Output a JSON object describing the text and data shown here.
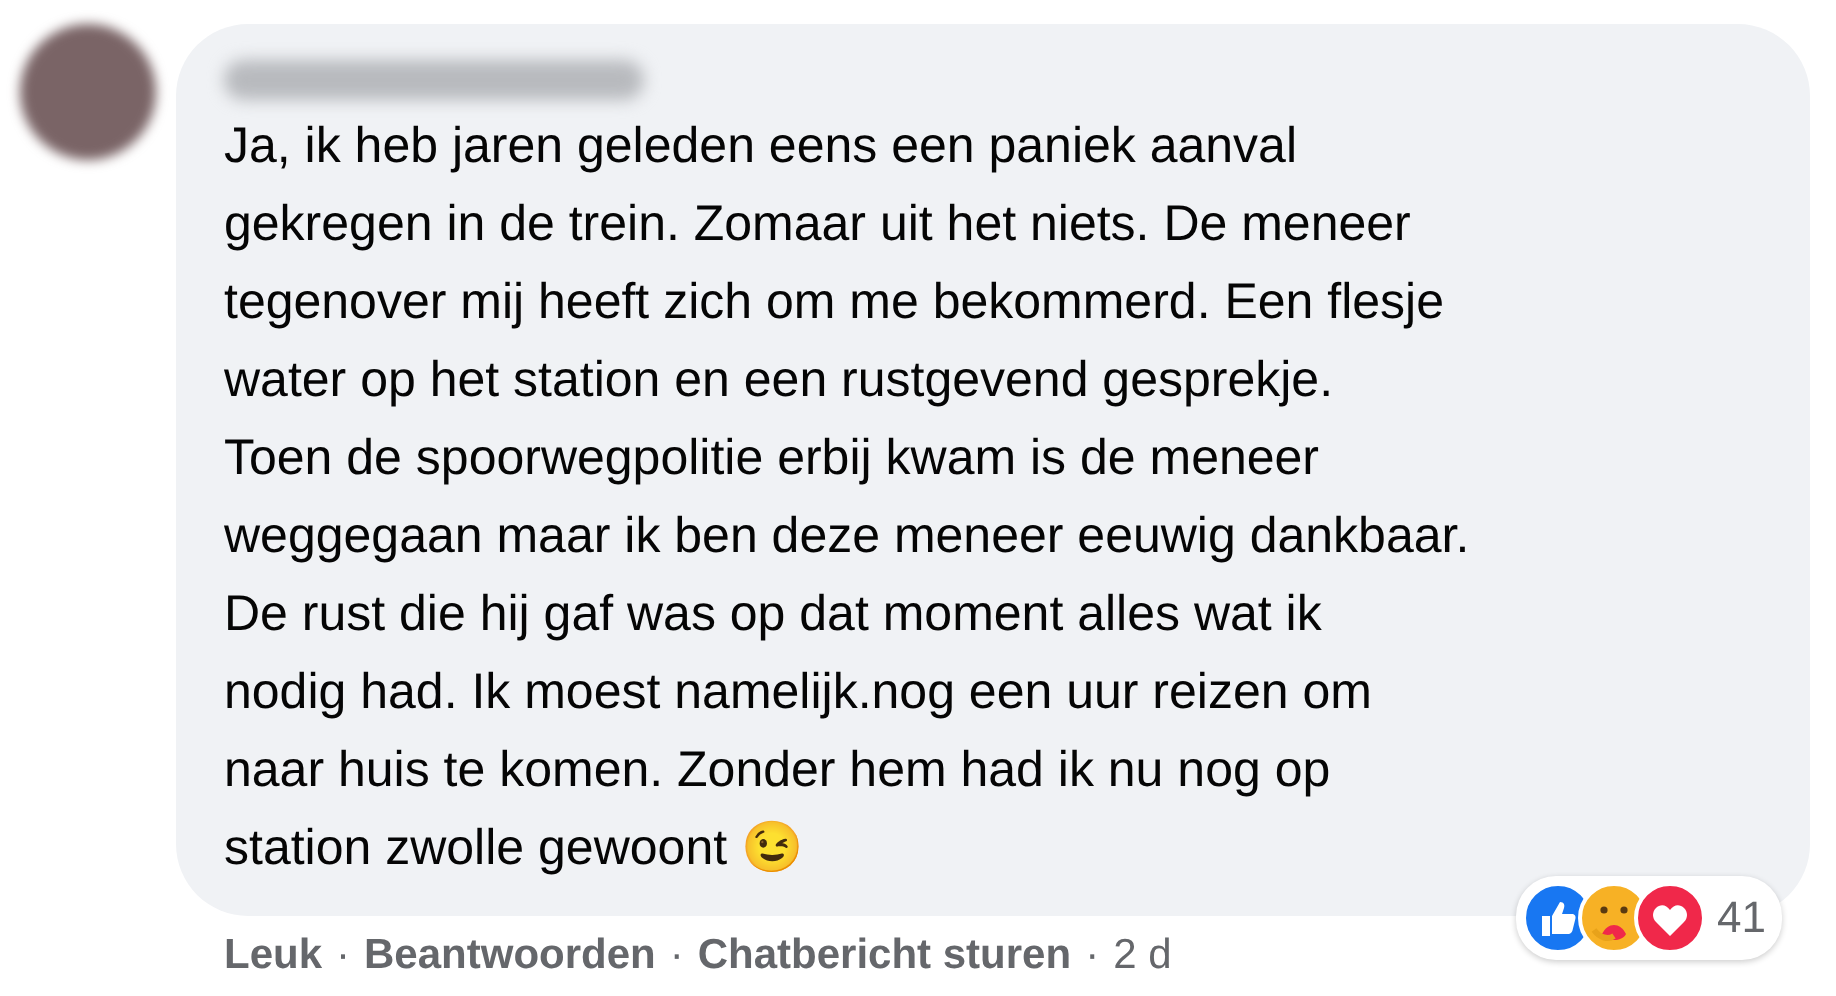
{
  "comment": {
    "text": "Ja, ik heb jaren geleden eens een paniek aanval\ngekregen in de trein. Zomaar uit het niets. De meneer\ntegenover mij heeft zich om me bekommerd. Een flesje\nwater op het station en een rustgevend gesprekje.\nToen de spoorwegpolitie erbij kwam is de meneer\nweggegaan maar ik ben deze meneer eeuwig dankbaar.\nDe rust die hij gaf was op dat moment alles wat ik\nnodig had. Ik moest namelijk.nog een uur reizen om\nnaar huis te komen. Zonder hem had ik nu nog op\nstation zwolle gewoont 😉",
    "reactions": {
      "icons": [
        {
          "kind": "like"
        },
        {
          "kind": "care"
        },
        {
          "kind": "love"
        }
      ],
      "count": "41"
    },
    "actions": [
      "Leuk",
      "Beantwoorden",
      "Chatbericht sturen"
    ],
    "separator": "·",
    "time": "2 d"
  }
}
